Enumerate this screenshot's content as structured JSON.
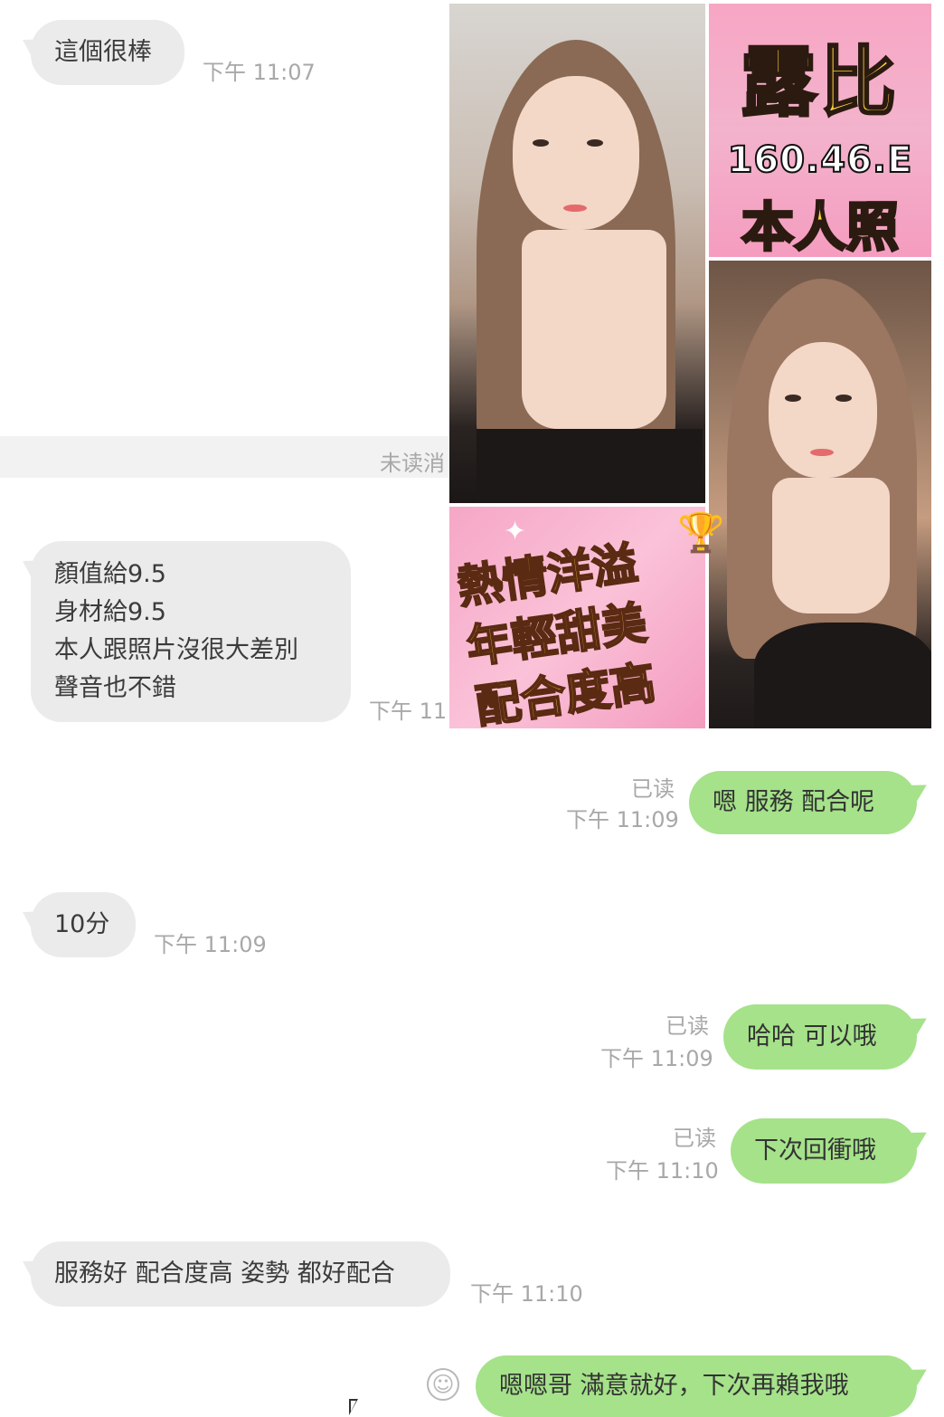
{
  "messages": {
    "m1": {
      "text": "這個很棒",
      "time": "下午 11:07"
    },
    "unread_divider": "未读消",
    "m2": {
      "lines": [
        "顏值給9.5",
        "身材給9.5",
        "本人跟照片沒很大差別",
        "聲音也不錯"
      ],
      "time": "下午 11"
    },
    "m3": {
      "text": "嗯 服務 配合呢",
      "read": "已读",
      "time": "下午 11:09"
    },
    "m4": {
      "text": "10分",
      "time": "下午 11:09"
    },
    "m5": {
      "text": "哈哈 可以哦",
      "read": "已读",
      "time": "下午 11:09"
    },
    "m6": {
      "text": "下次回衝哦",
      "read": "已读",
      "time": "下午 11:10"
    },
    "m7": {
      "text": "服務好 配合度高 姿勢 都好配合",
      "time": "下午 11:10"
    },
    "m8": {
      "text": "嗯嗯哥 滿意就好，下次再賴我哦"
    }
  },
  "promo": {
    "name": "露比",
    "stats": "160.46.E",
    "selfie_label": "本人照",
    "tags": [
      "熱情洋溢",
      "年輕甜美",
      "配合度高"
    ]
  },
  "icons": {
    "emoji": "smiley-icon",
    "cursor": "mouse-cursor-icon",
    "trophy": "trophy-icon"
  },
  "colors": {
    "incoming": "#ebebeb",
    "outgoing": "#a5e28a",
    "meta": "#a8a8a8"
  }
}
